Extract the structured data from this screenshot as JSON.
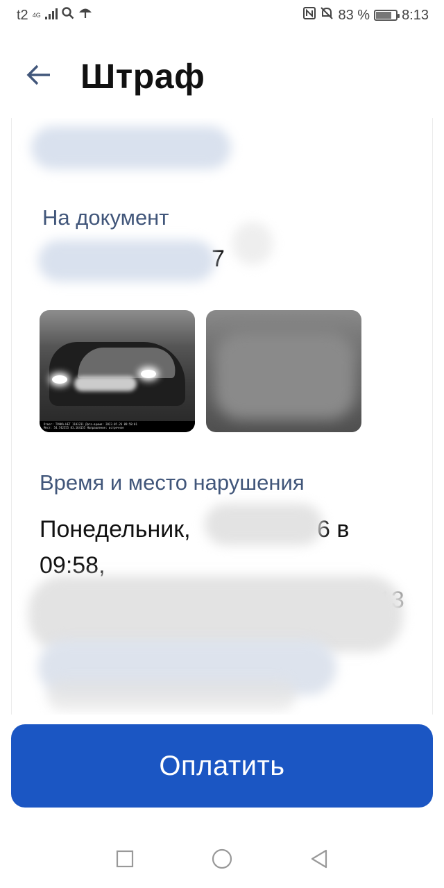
{
  "status_bar": {
    "carrier": "t2",
    "network": "4G",
    "battery_percent_label": "83 %",
    "battery_level": 0.83,
    "time": "8:13"
  },
  "header": {
    "title": "Штраф",
    "back_icon": "arrow-left-icon"
  },
  "details": {
    "document_label": "На документ",
    "document_value_visible": "7",
    "violation_label": "Время и место нарушения",
    "violation_line1_prefix": "Понедельник,",
    "violation_line1_suffix": "6 в",
    "violation_line2": "09:58,",
    "partial_fragment": "13"
  },
  "photos": {
    "caption_1": "Ответ: ТОЧКА-НЕТ 1103231 Дата-время: 2023.05.26 09:58:01",
    "caption_2": "Мест: 54.742555 83.164155  Направление: встречное"
  },
  "actions": {
    "pay_label": "Оплатить"
  },
  "colors": {
    "accent": "#1b56c3",
    "label": "#41567a"
  },
  "nav": {
    "recents_icon": "square-icon",
    "home_icon": "circle-icon",
    "back_icon": "triangle-back-icon"
  }
}
